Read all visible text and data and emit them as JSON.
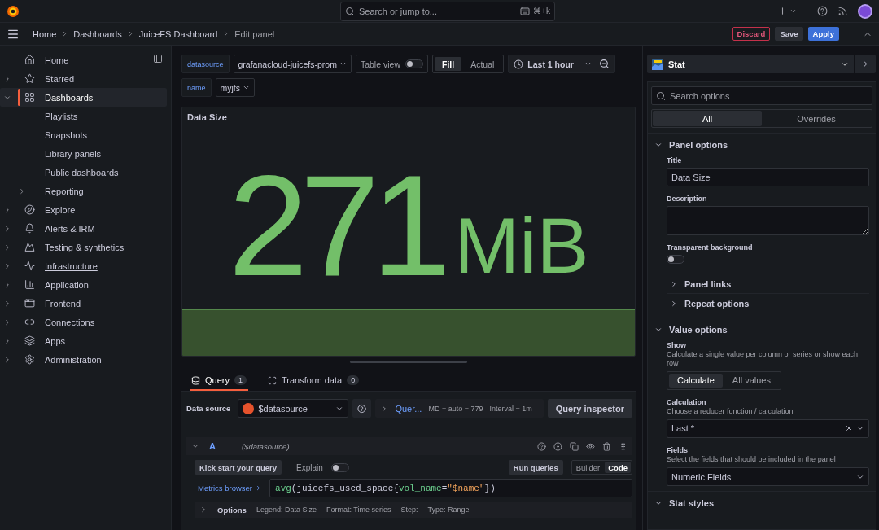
{
  "top_bar": {
    "search": {
      "placeholder": "Search or jump to..."
    },
    "shortcut": "⌘+k"
  },
  "breadcrumbs": [
    "Home",
    "Dashboards",
    "JuiceFS Dashboard",
    "Edit panel"
  ],
  "actions": [
    {
      "label": "Discard",
      "kind": "danger"
    },
    {
      "label": "Save",
      "kind": "secondary"
    },
    {
      "label": "Apply",
      "kind": "primary"
    }
  ],
  "sidebar": {
    "items": [
      {
        "label": "Home",
        "expandable": false,
        "selected": false,
        "hovered": false
      },
      {
        "label": "Starred",
        "expandable": true,
        "selected": false,
        "hovered": false
      },
      {
        "label": "Dashboards",
        "expandable": true,
        "expanded": true,
        "selected": true,
        "hovered": false,
        "children": [
          {
            "label": "Playlists",
            "expandable": false,
            "selected": false,
            "hovered": false
          },
          {
            "label": "Snapshots",
            "expandable": false,
            "selected": false,
            "hovered": false
          },
          {
            "label": "Library panels",
            "expandable": false,
            "selected": false,
            "hovered": false
          },
          {
            "label": "Public dashboards",
            "expandable": false,
            "selected": false,
            "hovered": false
          },
          {
            "label": "Reporting",
            "expandable": true,
            "selected": false,
            "hovered": false
          }
        ]
      },
      {
        "label": "Explore",
        "expandable": true,
        "selected": false,
        "hovered": false
      },
      {
        "label": "Alerts & IRM",
        "expandable": true,
        "selected": false,
        "hovered": false
      },
      {
        "label": "Testing & synthetics",
        "expandable": true,
        "selected": false,
        "hovered": false
      },
      {
        "label": "Infrastructure",
        "expandable": true,
        "selected": false,
        "hovered": true
      },
      {
        "label": "Application",
        "expandable": true,
        "selected": false,
        "hovered": false
      },
      {
        "label": "Frontend",
        "expandable": true,
        "selected": false,
        "hovered": false
      },
      {
        "label": "Connections",
        "expandable": true,
        "selected": false,
        "hovered": false
      },
      {
        "label": "Apps",
        "expandable": true,
        "selected": false,
        "hovered": false
      },
      {
        "label": "Administration",
        "expandable": true,
        "selected": false,
        "hovered": false
      }
    ]
  },
  "variables": [
    {
      "label": "datasource",
      "value": "grafanacloud-juicefs-prom"
    },
    {
      "label": "name",
      "value": "myjfs"
    }
  ],
  "table_view": {
    "label": "Table view",
    "on": false
  },
  "fill_modes": [
    {
      "label": "Fill",
      "selected": true
    },
    {
      "label": "Actual",
      "selected": false
    }
  ],
  "time_range": "Last 1 hour",
  "panel": {
    "title": "Data Size",
    "value": "271",
    "unit": "MiB"
  },
  "query_tabs": [
    {
      "label": "Query",
      "count": "1",
      "selected": true
    },
    {
      "label": "Transform data",
      "count": "0",
      "selected": false
    }
  ],
  "query_bar": {
    "label": "Data source",
    "datasource": "$datasource",
    "options_link": "Quer...",
    "max_data_points": "MD = auto = 779",
    "interval": "Interval = 1m",
    "inspector": "Query inspector"
  },
  "query": {
    "ref": "A",
    "datasource": "($datasource)",
    "expanded": true,
    "kick_start": "Kick start your query",
    "explain": {
      "label": "Explain",
      "on": false
    },
    "run": "Run queries",
    "modes": [
      {
        "label": "Builder",
        "selected": false
      },
      {
        "label": "Code",
        "selected": true
      }
    ],
    "metrics_browser": "Metrics browser",
    "expression": [
      {
        "text": "avg",
        "kind": "function"
      },
      {
        "text": "(juicefs_used_space{",
        "kind": "plain"
      },
      {
        "text": "vol_name",
        "kind": "label"
      },
      {
        "text": "=",
        "kind": "plain"
      },
      {
        "text": "\"$name\"",
        "kind": "string"
      },
      {
        "text": "})",
        "kind": "plain"
      }
    ],
    "options": {
      "label": "Options",
      "expanded": false,
      "details": [
        "Legend: Data Size",
        "Format: Time series",
        "Step:",
        "Type: Range"
      ]
    }
  },
  "visualization": "Stat",
  "options_search": {
    "placeholder": "Search options"
  },
  "option_tabs": [
    {
      "label": "All",
      "selected": true
    },
    {
      "label": "Overrides",
      "selected": false
    }
  ],
  "panel_options": {
    "heading": "Panel options",
    "expanded": true,
    "title_label": "Title",
    "title_value": "Data Size",
    "description_label": "Description",
    "transparent_label": "Transparent background",
    "transparent_on": false,
    "subsections": [
      {
        "label": "Panel links",
        "expanded": false
      },
      {
        "label": "Repeat options",
        "expanded": false
      }
    ]
  },
  "value_options": {
    "heading": "Value options",
    "expanded": true,
    "show_label": "Show",
    "show_hint": "Calculate a single value per column or series or show each row",
    "show_modes": [
      {
        "label": "Calculate",
        "selected": true
      },
      {
        "label": "All values",
        "selected": false
      }
    ],
    "calculation_label": "Calculation",
    "calculation_hint": "Choose a reducer function / calculation",
    "calculation_value": "Last *",
    "fields_label": "Fields",
    "fields_hint": "Select the fields that should be included in the panel",
    "fields_value": "Numeric Fields"
  },
  "stat_styles": {
    "heading": "Stat styles",
    "expanded": true
  }
}
